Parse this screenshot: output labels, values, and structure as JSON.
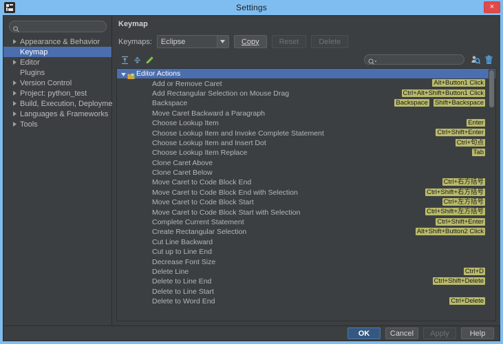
{
  "window": {
    "title": "Settings",
    "app_icon": "pycharm-icon",
    "close_label": "×"
  },
  "sidebar": {
    "search_placeholder": "",
    "search_value": "",
    "items": [
      {
        "label": "Appearance & Behavior",
        "expandable": true,
        "selected": false
      },
      {
        "label": "Keymap",
        "expandable": false,
        "selected": true
      },
      {
        "label": "Editor",
        "expandable": true,
        "selected": false
      },
      {
        "label": "Plugins",
        "expandable": false,
        "selected": false
      },
      {
        "label": "Version Control",
        "expandable": true,
        "selected": false
      },
      {
        "label": "Project: python_test",
        "expandable": true,
        "selected": false
      },
      {
        "label": "Build, Execution, Deployment",
        "expandable": true,
        "selected": false
      },
      {
        "label": "Languages & Frameworks",
        "expandable": true,
        "selected": false
      },
      {
        "label": "Tools",
        "expandable": true,
        "selected": false
      }
    ]
  },
  "panel": {
    "title": "Keymap",
    "keymaps_label": "Keymaps:",
    "keymap_value": "Eclipse",
    "buttons": {
      "copy": "Copy",
      "reset": "Reset",
      "delete": "Delete"
    },
    "toolbar_icons": [
      "expand-all-icon",
      "collapse-all-icon",
      "edit-shortcut-icon",
      "find-actions-by-shortcut-icon",
      "clear-filter-icon"
    ],
    "filter_placeholder": "",
    "filter_value": ""
  },
  "tree": {
    "group": {
      "label": "Editor Actions",
      "expanded": true,
      "selected": true
    },
    "rows": [
      {
        "label": "Add or Remove Caret",
        "shortcuts": [
          "Alt+Button1 Click"
        ]
      },
      {
        "label": "Add Rectangular Selection on Mouse Drag",
        "shortcuts": [
          "Ctrl+Alt+Shift+Button1 Click"
        ]
      },
      {
        "label": "Backspace",
        "shortcuts": [
          "Backspace",
          "Shift+Backspace"
        ]
      },
      {
        "label": "Move Caret Backward a Paragraph",
        "shortcuts": []
      },
      {
        "label": "Choose Lookup Item",
        "shortcuts": [
          "Enter"
        ]
      },
      {
        "label": "Choose Lookup Item and Invoke Complete Statement",
        "shortcuts": [
          "Ctrl+Shift+Enter"
        ]
      },
      {
        "label": "Choose Lookup Item and Insert Dot",
        "shortcuts": [
          "Ctrl+句点"
        ]
      },
      {
        "label": "Choose Lookup Item Replace",
        "shortcuts": [
          "Tab"
        ]
      },
      {
        "label": "Clone Caret Above",
        "shortcuts": []
      },
      {
        "label": "Clone Caret Below",
        "shortcuts": []
      },
      {
        "label": "Move Caret to Code Block End",
        "shortcuts": [
          "Ctrl+右方括号"
        ]
      },
      {
        "label": "Move Caret to Code Block End with Selection",
        "shortcuts": [
          "Ctrl+Shift+右方括号"
        ]
      },
      {
        "label": "Move Caret to Code Block Start",
        "shortcuts": [
          "Ctrl+左方括号"
        ]
      },
      {
        "label": "Move Caret to Code Block Start with Selection",
        "shortcuts": [
          "Ctrl+Shift+左方括号"
        ]
      },
      {
        "label": "Complete Current Statement",
        "shortcuts": [
          "Ctrl+Shift+Enter"
        ]
      },
      {
        "label": "Create Rectangular Selection",
        "shortcuts": [
          "Alt+Shift+Button2 Click"
        ]
      },
      {
        "label": "Cut Line Backward",
        "shortcuts": []
      },
      {
        "label": "Cut up to Line End",
        "shortcuts": []
      },
      {
        "label": "Decrease Font Size",
        "shortcuts": []
      },
      {
        "label": "Delete Line",
        "shortcuts": [
          "Ctrl+D"
        ]
      },
      {
        "label": "Delete to Line End",
        "shortcuts": [
          "Ctrl+Shift+Delete"
        ]
      },
      {
        "label": "Delete to Line Start",
        "shortcuts": []
      },
      {
        "label": "Delete to Word End",
        "shortcuts": [
          "Ctrl+Delete"
        ]
      }
    ],
    "scrollbar": {
      "thumb_top": 1,
      "thumb_height": 54
    }
  },
  "footer": {
    "ok": "OK",
    "cancel": "Cancel",
    "apply": "Apply",
    "help": "Help"
  },
  "colors": {
    "titlebar": "#7fbdf0",
    "panel_bg": "#3c3f41",
    "selection": "#4b6eaf",
    "shortcut_badge": "#b9ba6a",
    "primary_button": "#365880",
    "close_button": "#e04a4a"
  }
}
